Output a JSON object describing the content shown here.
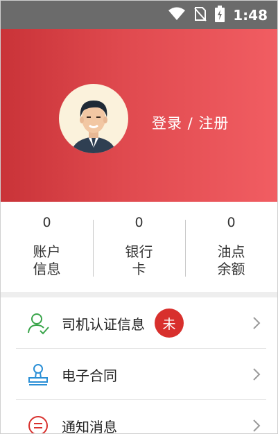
{
  "status_bar": {
    "time": "1:48",
    "icons": [
      "wifi-icon",
      "no-sim-icon",
      "battery-charging-icon"
    ]
  },
  "profile": {
    "avatar_icon": "avatar-man-icon",
    "login_label": "登录 / 注册"
  },
  "stats": [
    {
      "value": "0",
      "label": "账户\n信息"
    },
    {
      "value": "0",
      "label": "银行\n卡"
    },
    {
      "value": "0",
      "label": "油点\n余额"
    }
  ],
  "menu": [
    {
      "label": "司机认证信息",
      "icon": "user-check-icon",
      "badge": "未"
    },
    {
      "label": "电子合同",
      "icon": "stamp-icon"
    },
    {
      "label": "通知消息",
      "icon": "message-icon"
    }
  ],
  "colors": {
    "hero_start": "#c93338",
    "hero_end": "#f15d62",
    "badge": "#d8302d",
    "icon_green": "#3aa54b",
    "icon_blue": "#2a8fd6",
    "icon_red": "#d8302d"
  }
}
